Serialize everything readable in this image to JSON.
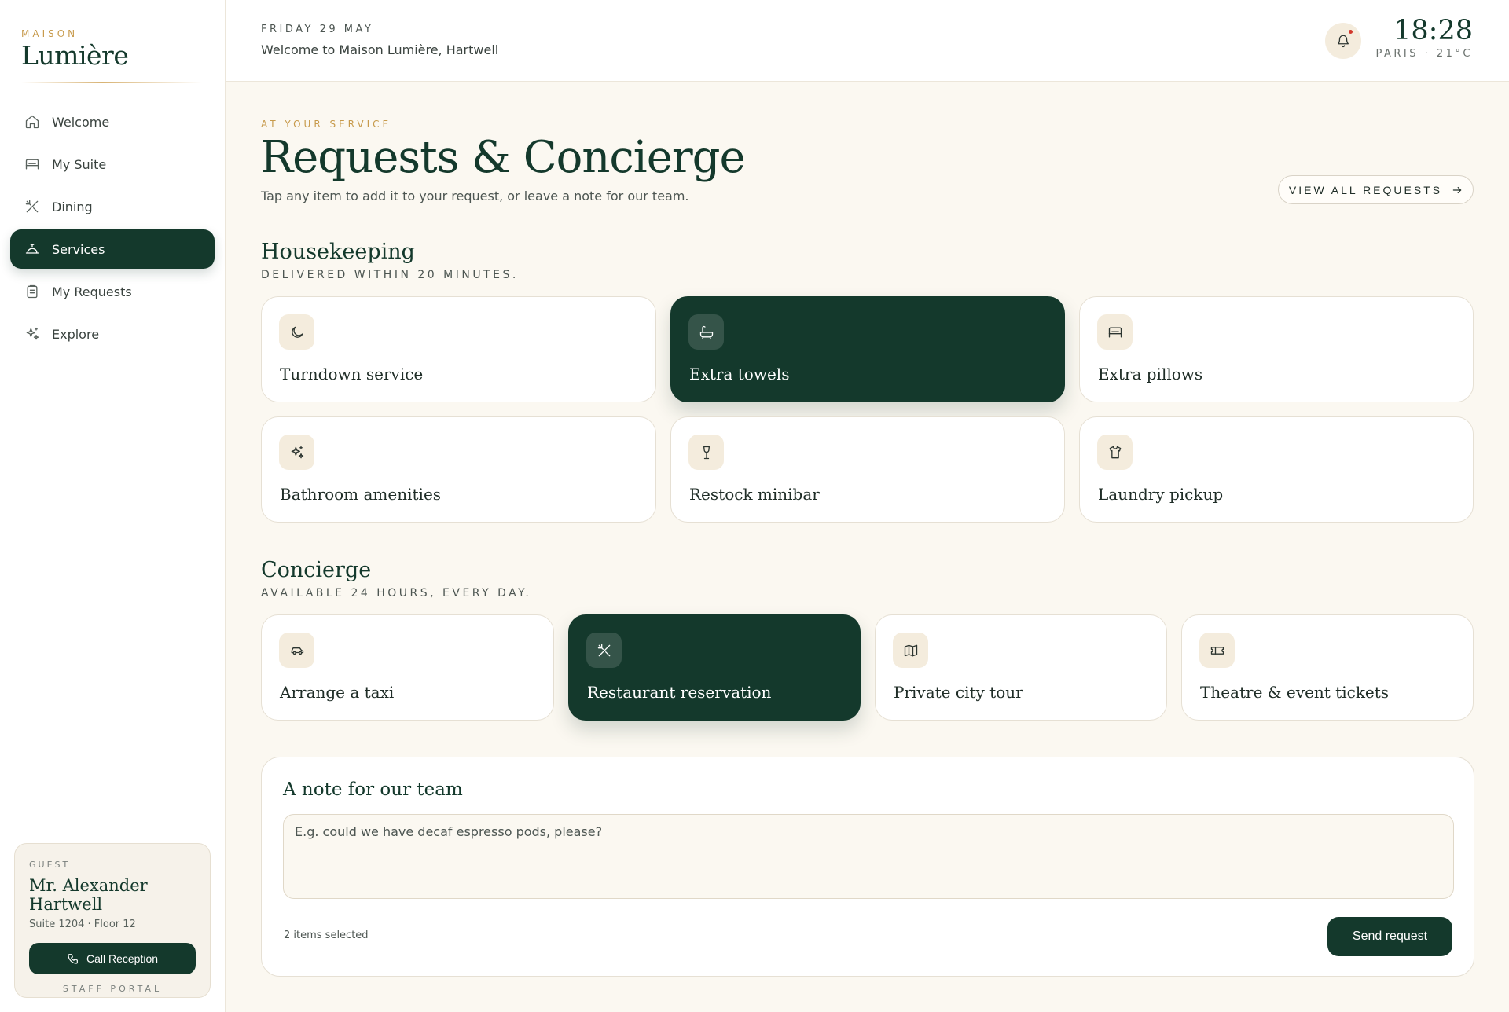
{
  "brand": {
    "small": "MAISON",
    "name": "Lumière"
  },
  "nav": {
    "items": [
      {
        "label": "Welcome",
        "icon": "home-icon"
      },
      {
        "label": "My Suite",
        "icon": "bed-icon"
      },
      {
        "label": "Dining",
        "icon": "utensils-icon"
      },
      {
        "label": "Services",
        "icon": "concierge-bell-icon",
        "active": true
      },
      {
        "label": "My Requests",
        "icon": "clipboard-icon"
      },
      {
        "label": "Explore",
        "icon": "sparkles-icon"
      }
    ]
  },
  "guest": {
    "label": "GUEST",
    "name": "Mr. Alexander Hartwell",
    "room": "Suite 1204 · Floor 12",
    "call_label": "Call Reception",
    "staff_label": "STAFF PORTAL"
  },
  "header": {
    "date": "FRIDAY 29 MAY",
    "welcome": "Welcome to Maison Lumière, Hartwell",
    "time": "18:28",
    "place": "PARIS · 21°C"
  },
  "page": {
    "kicker": "AT YOUR SERVICE",
    "title": "Requests & Concierge",
    "subtitle": "Tap any item to add it to your request, or leave a note for our team.",
    "view_all": "VIEW ALL REQUESTS"
  },
  "housekeeping": {
    "title": "Housekeeping",
    "subtitle": "DELIVERED WITHIN 20 MINUTES.",
    "items": [
      {
        "label": "Turndown service",
        "icon": "moon-icon",
        "selected": false
      },
      {
        "label": "Extra towels",
        "icon": "bath-icon",
        "selected": true
      },
      {
        "label": "Extra pillows",
        "icon": "bed-icon",
        "selected": false
      },
      {
        "label": "Bathroom amenities",
        "icon": "sparkles-icon",
        "selected": false
      },
      {
        "label": "Restock minibar",
        "icon": "wine-glass-icon",
        "selected": false
      },
      {
        "label": "Laundry pickup",
        "icon": "shirt-icon",
        "selected": false
      }
    ]
  },
  "concierge": {
    "title": "Concierge",
    "subtitle": "AVAILABLE 24 HOURS, EVERY DAY.",
    "items": [
      {
        "label": "Arrange a taxi",
        "icon": "car-icon",
        "selected": false
      },
      {
        "label": "Restaurant reservation",
        "icon": "utensils-icon",
        "selected": true
      },
      {
        "label": "Private city tour",
        "icon": "map-icon",
        "selected": false
      },
      {
        "label": "Theatre & event tickets",
        "icon": "ticket-icon",
        "selected": false
      }
    ]
  },
  "note": {
    "title": "A note for our team",
    "placeholder": "E.g. could we have decaf espresso pods, please?",
    "count": "2 items selected",
    "send_label": "Send request"
  },
  "colors": {
    "accent": "#14392c",
    "gold": "#c79a4b",
    "background": "#fbf8f1",
    "notification": "#d2382c"
  }
}
